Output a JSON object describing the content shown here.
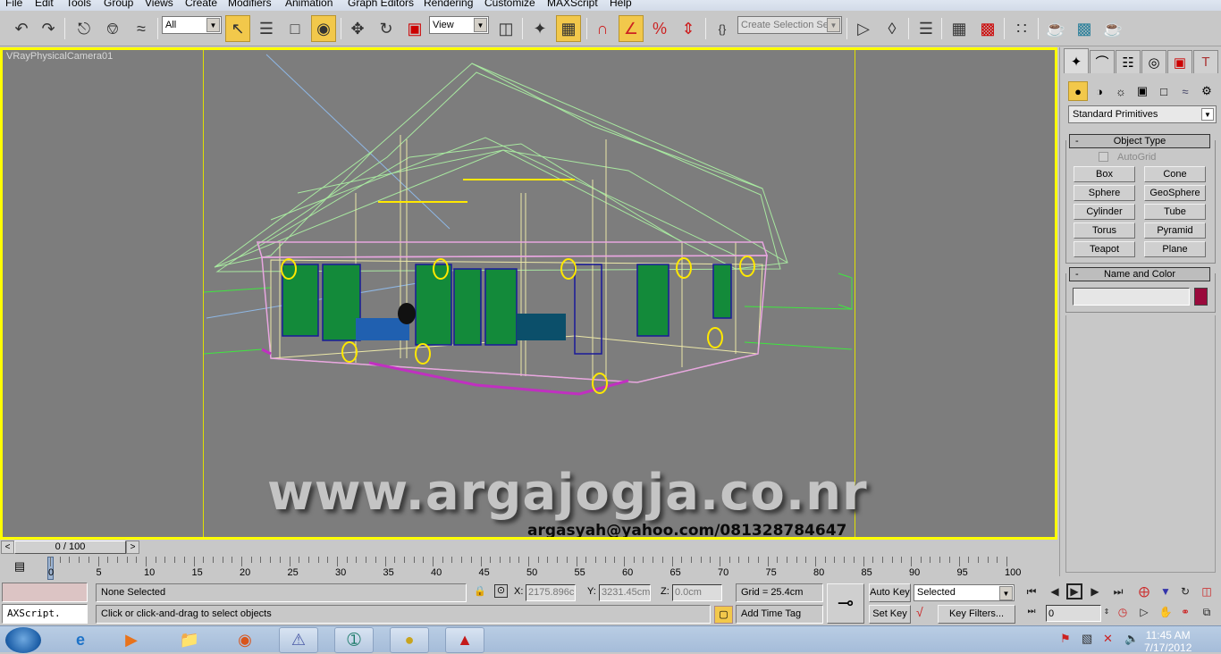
{
  "menu": [
    "File",
    "Edit",
    "Tools",
    "Group",
    "Views",
    "Create",
    "Modifiers",
    "Animation",
    "Graph Editors",
    "Rendering",
    "Customize",
    "MAXScript",
    "Help"
  ],
  "toolbar": {
    "selection_filter": "All",
    "reference_coord": "View",
    "selection_set_placeholder": "Create Selection Set",
    "icons": [
      "undo-icon",
      "redo-icon",
      "select-and-link-icon",
      "unlink-selection-icon",
      "bind-to-space-warp-icon",
      "select-object-icon",
      "select-by-name-icon",
      "rectangular-selection-icon",
      "window-crossing-icon",
      "select-and-move-icon",
      "select-and-rotate-icon",
      "select-and-scale-icon",
      "use-pivot-center-icon",
      "select-and-manipulate-icon",
      "keyboard-shortcut-override-icon",
      "snaps-toggle-icon",
      "angle-snap-icon",
      "percent-snap-icon",
      "spinner-snap-icon",
      "edit-named-selection-icon",
      "mirror-icon",
      "align-icon",
      "layer-manager-icon",
      "curve-editor-icon",
      "schematic-view-icon",
      "material-editor-icon",
      "render-setup-icon",
      "rendered-frame-window-icon",
      "render-production-icon"
    ]
  },
  "viewport": {
    "label": "VRayPhysicalCamera01",
    "watermark": "www.argajogja.co.nr",
    "contact": "argasyah@yahoo.com/081328784647",
    "border_color": "#ffff00",
    "background_color": "#7d7d7d"
  },
  "command_panel": {
    "tabs": [
      "create-tab",
      "modify-tab",
      "hierarchy-tab",
      "motion-tab",
      "display-tab",
      "utilities-tab"
    ],
    "subcategories": [
      "geometry",
      "shapes",
      "lights",
      "cameras",
      "helpers",
      "space-warps",
      "systems"
    ],
    "category": "Standard Primitives",
    "object_type": {
      "title": "Object Type",
      "autogrid": "AutoGrid",
      "buttons": [
        "Box",
        "Cone",
        "Sphere",
        "GeoSphere",
        "Cylinder",
        "Tube",
        "Torus",
        "Pyramid",
        "Teapot",
        "Plane"
      ]
    },
    "name_and_color": {
      "title": "Name and Color",
      "name_value": "",
      "color": "#9a0a3c"
    }
  },
  "time_slider": {
    "value": "0 / 100",
    "current_frame": 0,
    "total_frames": 100
  },
  "trackbar": {
    "labels": [
      "0",
      "5",
      "10",
      "15",
      "20",
      "25",
      "30",
      "35",
      "40",
      "45",
      "50",
      "55",
      "60",
      "65",
      "70",
      "75",
      "80",
      "85",
      "90",
      "95",
      "100"
    ]
  },
  "status": {
    "maxscript_listener": "AXScript.",
    "selection": "None Selected",
    "prompt": "Click or click-and-drag to select objects",
    "x_label": "X:",
    "x_value": "2175.896c",
    "y_label": "Y:",
    "y_value": "3231.45cm",
    "z_label": "Z:",
    "z_value": "0.0cm",
    "grid": "Grid = 25.4cm",
    "add_time_tag": "Add Time Tag",
    "auto_key": "Auto Key",
    "set_key": "Set Key",
    "key_mode": "Selected",
    "key_filters": "Key Filters...",
    "frame_value": "0"
  },
  "taskbar": {
    "apps": [
      "internet-explorer",
      "windows-media-player",
      "windows-explorer",
      "firefox",
      "action-center-app",
      "3ds-max",
      "sothink-swf",
      "autocad"
    ],
    "time": "11:45 AM",
    "date": "7/17/2012"
  }
}
